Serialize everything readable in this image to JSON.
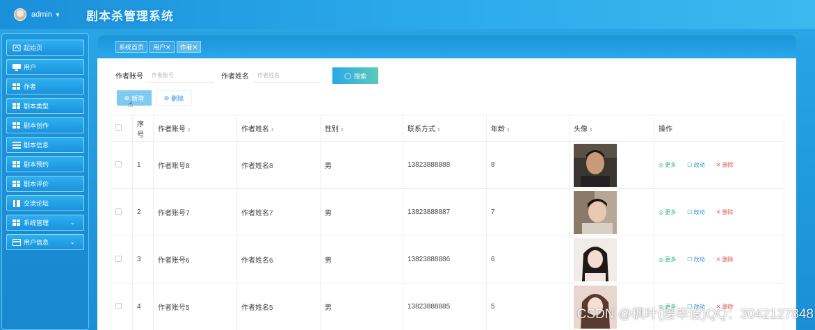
{
  "header": {
    "username": "admin",
    "app_title": "剧本杀管理系统"
  },
  "sidebar": {
    "items": [
      {
        "label": "起始页",
        "icon": "home-icon"
      },
      {
        "label": "用户",
        "icon": "monitor-icon"
      },
      {
        "label": "作者",
        "icon": "grid-icon"
      },
      {
        "label": "剧本类型",
        "icon": "grid-icon"
      },
      {
        "label": "剧本创作",
        "icon": "grid-icon"
      },
      {
        "label": "剧本信息",
        "icon": "list-icon"
      },
      {
        "label": "剧本预约",
        "icon": "grid-icon"
      },
      {
        "label": "剧本评价",
        "icon": "grid-icon"
      },
      {
        "label": "交流论坛",
        "icon": "book-icon"
      },
      {
        "label": "系统管理",
        "icon": "grid-icon"
      },
      {
        "label": "用户信息",
        "icon": "card-icon"
      }
    ]
  },
  "tabs": [
    {
      "label": "系统首页"
    },
    {
      "label": "用户✕"
    },
    {
      "label": "作者✕"
    }
  ],
  "search": {
    "account_label": "作者账号",
    "account_placeholder": "作者账号",
    "name_label": "作者姓名",
    "name_placeholder": "作者姓名",
    "search_button": "搜索"
  },
  "actions": {
    "add_button": "新增",
    "delete_button": "删除"
  },
  "table": {
    "headers": [
      "序号",
      "作者账号",
      "作者姓名",
      "性别",
      "联系方式",
      "年龄",
      "头像",
      "操作"
    ],
    "rows": [
      {
        "index": "1",
        "account": "作者账号8",
        "name": "作者姓名8",
        "gender": "男",
        "phone": "13823888888",
        "age": "8"
      },
      {
        "index": "2",
        "account": "作者账号7",
        "name": "作者姓名7",
        "gender": "男",
        "phone": "13823888887",
        "age": "7"
      },
      {
        "index": "3",
        "account": "作者账号6",
        "name": "作者姓名6",
        "gender": "男",
        "phone": "13823888886",
        "age": "6"
      },
      {
        "index": "4",
        "account": "作者账号5",
        "name": "作者姓名5",
        "gender": "男",
        "phone": "13823888885",
        "age": "5"
      }
    ],
    "row_actions": {
      "more": "更多",
      "edit": "改动",
      "delete": "删除"
    }
  },
  "watermark": "CSDN @枫叶(接毕设)QQ：3042127848"
}
